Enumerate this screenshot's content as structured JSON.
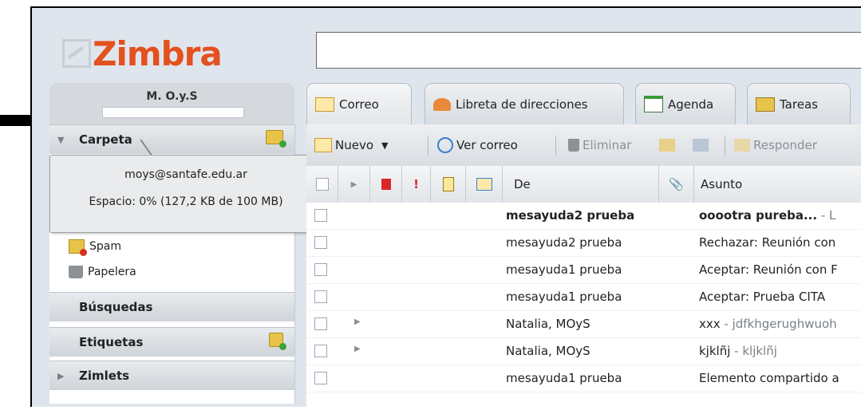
{
  "logo": {
    "text": "Zimbra"
  },
  "search": {
    "value": ""
  },
  "user": {
    "name": "M. O.y.S"
  },
  "tooltip": {
    "email": "moys@santafe.edu.ar",
    "quota": "Espacio: 0% (127,2 KB de 100 MB)"
  },
  "sidebar": {
    "folders_label": "Carpeta",
    "items": [
      {
        "label": "Spam",
        "icon": "spam-folder-icon"
      },
      {
        "label": "Papelera",
        "icon": "trash-icon"
      }
    ],
    "searches_label": "Búsquedas",
    "tags_label": "Etiquetas",
    "zimlets_label": "Zimlets"
  },
  "tabs": [
    {
      "label": "Correo",
      "icon": "mail-icon"
    },
    {
      "label": "Libreta de direcciones",
      "icon": "contacts-icon"
    },
    {
      "label": "Agenda",
      "icon": "calendar-icon"
    },
    {
      "label": "Tareas",
      "icon": "tasks-icon"
    }
  ],
  "toolbar": {
    "new_label": "Nuevo",
    "view_mail_label": "Ver correo",
    "delete_label": "Eliminar",
    "reply_label": "Responder"
  },
  "columns": {
    "from": "De",
    "subject": "Asunto"
  },
  "messages": [
    {
      "from": "mesayuda2 prueba",
      "subject": "ooootra pureba...",
      "fragment": " - L",
      "unread": true
    },
    {
      "from": "mesayuda2 prueba",
      "subject": "Rechazar: Reunión con",
      "fragment": "",
      "unread": false
    },
    {
      "from": "mesayuda1 prueba",
      "subject": "Aceptar: Reunión con F",
      "fragment": "",
      "unread": false
    },
    {
      "from": "mesayuda1 prueba",
      "subject": "Aceptar: Prueba CITA",
      "fragment": "",
      "unread": false
    },
    {
      "from": "Natalia, MOyS",
      "subject": "xxx",
      "fragment": " - jdfkhgerughwuoh",
      "unread": false
    },
    {
      "from": "Natalia, MOyS",
      "subject": "kjklñj",
      "fragment": " - kljklñj",
      "unread": false
    },
    {
      "from": "mesayuda1 prueba",
      "subject": "Elemento compartido a",
      "fragment": "",
      "unread": false
    }
  ],
  "colors": {
    "brand": "#e4501e",
    "chrome": "#dfe5ec"
  }
}
